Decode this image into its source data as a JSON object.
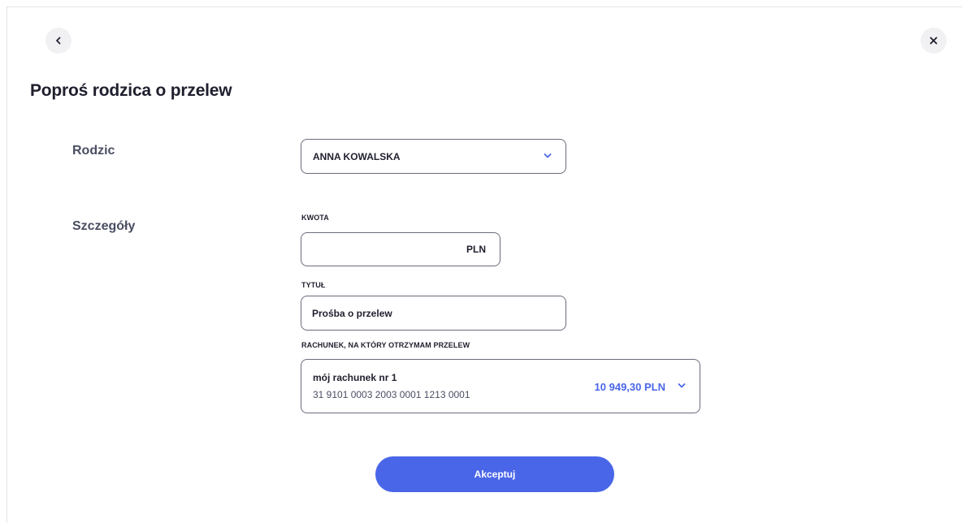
{
  "dialog": {
    "title": "Poproś rodzica o przelew",
    "back_icon": "chevron-left-icon",
    "close_icon": "close-icon"
  },
  "sections": {
    "parent_label": "Rodzic",
    "details_label": "Szczegóły"
  },
  "parent_select": {
    "value": "ANNA KOWALSKA",
    "icon": "chevron-down-icon"
  },
  "amount": {
    "label": "KWOTA",
    "value": "",
    "currency": "PLN"
  },
  "transfer_title": {
    "label": "TYTUŁ",
    "value": "Prośba o przelew"
  },
  "account": {
    "label": "RACHUNEK, NA KTÓRY OTRZYMAM PRZELEW",
    "name": "mój rachunek nr 1",
    "number": "31 9101 0003 2003 0001 1213 0001",
    "balance": "10 949,30 PLN",
    "icon": "chevron-down-icon"
  },
  "actions": {
    "accept_label": "Akceptuj"
  },
  "colors": {
    "accent": "#4a66e8",
    "text": "#1f1f2e",
    "section_label": "#4a4e62",
    "border": "#6a6c7c"
  }
}
